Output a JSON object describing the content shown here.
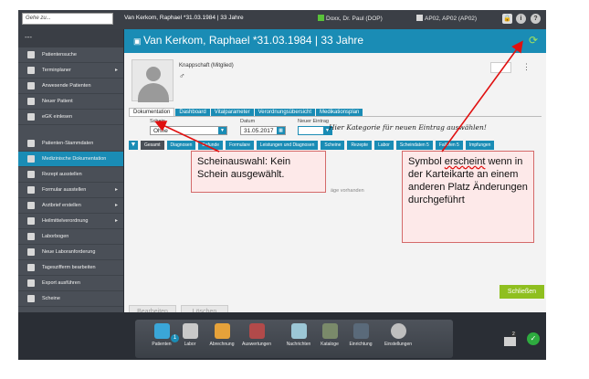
{
  "topbar": {
    "search_placeholder": "Gehe zu...",
    "patient_title": "Van Kerkom, Raphael *31.03.1984 | 33 Jahre",
    "doctor": "Doxx, Dr. Paul (DOP)",
    "workstation": "AP02, AP02 (AP02)",
    "info_icon": "i",
    "help_icon": "?"
  },
  "sidebar": {
    "top_label": "---",
    "items": [
      {
        "label": "Patientensuche"
      },
      {
        "label": "Terminplaner",
        "arrow": "▸"
      },
      {
        "label": "Anwesende Patienten"
      },
      {
        "label": "Neuer Patient"
      },
      {
        "label": "eGK einlesen"
      },
      {
        "label": "Patienten-Stammdaten"
      },
      {
        "label": "Medizinische Dokumentation",
        "active": true
      },
      {
        "label": "Rezept ausstellen"
      },
      {
        "label": "Formular ausstellen",
        "arrow": "▸"
      },
      {
        "label": "Arztbrief erstellen",
        "arrow": "▸"
      },
      {
        "label": "Heilmittelverordnung",
        "arrow": "▸"
      },
      {
        "label": "Laborbogen"
      },
      {
        "label": "Neue Laboranforderung"
      },
      {
        "label": "Tageszifferm bearbeiten"
      },
      {
        "label": "Export ausführen"
      },
      {
        "label": "Scheine"
      }
    ]
  },
  "main": {
    "header_title": "Van Kerkom, Raphael *31.03.1984 | 33 Jahre",
    "insurance": "Knappschaft (Mitglied)",
    "gender_symbol": "♂",
    "tabs": [
      "Dokumentation",
      "Dashboard",
      "Vitalparameter",
      "Verordnungsübersicht",
      "Medikationsplan"
    ],
    "schein_label": "Schein",
    "schein_value": "Ohne",
    "datum_label": "Datum",
    "datum_value": "31.05.2017",
    "eintrag_label": "Neuer Eintrag",
    "eintrag_value": "",
    "handwritten_note": "Hier Kategorie für neuen Eintrag auswählen!",
    "filters": [
      "Gesamt",
      "Diagnosen",
      "Befunde",
      "Formulare",
      "Leistungen und Diagnosen",
      "Scheine",
      "Rezepte",
      "Labor",
      "Scheindaten 5",
      "Fallöfen 5",
      "Impfungen"
    ],
    "empty_text": "äge vorhanden",
    "btn_bearbeiten": "Bearbeiten",
    "btn_loeschen": "Löschen",
    "btn_schliessen": "Schließen"
  },
  "dock": {
    "items": [
      "Patienten",
      "Labor",
      "Abrechnung",
      "Auswertungen",
      "Nachrichten",
      "Kataloge",
      "Einrichtung",
      "Einstellungen"
    ],
    "badge": "1",
    "mail_count": "2"
  },
  "annotations": {
    "left_note": "Scheinauswahl: Kein Schein ausgewählt.",
    "right_note_prefix": "Symbol ",
    "right_note_emph": "erscheint",
    "right_note_suffix": " wenn in der Karteikarte an einem anderen Platz Änderungen durchgeführt"
  },
  "colors": {
    "accent": "#1a8cb5",
    "sidebar": "#4a4f57",
    "save": "#8fbf1f",
    "note_border": "#d46a6a",
    "arrow": "#e01010"
  }
}
